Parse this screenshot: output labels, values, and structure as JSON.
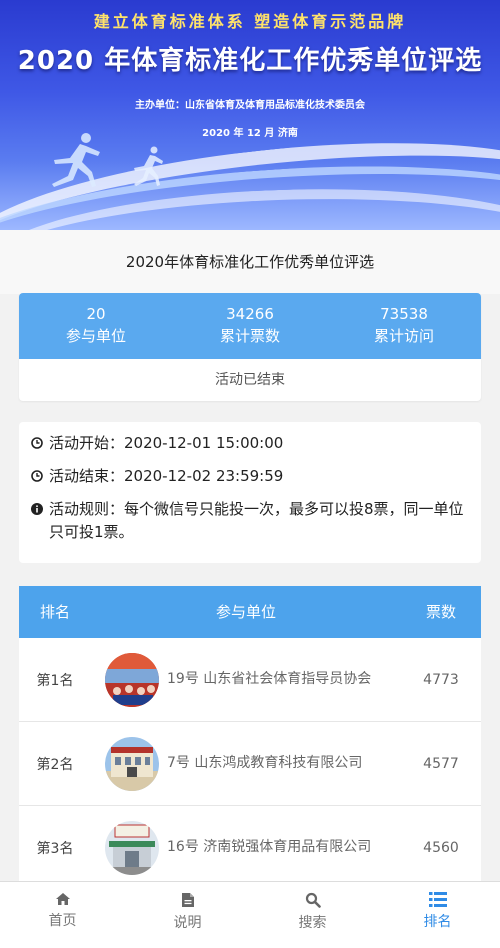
{
  "banner": {
    "slogan": "建立体育标准体系   塑造体育示范品牌",
    "title": "2020 年体育标准化工作优秀单位评选",
    "organizer": "主办单位：山东省体育及体育用品标准化技术委员会",
    "date": "2020 年 12 月  济南"
  },
  "page_title": "2020年体育标准化工作优秀单位评选",
  "stats": [
    {
      "value": "20",
      "label": "参与单位"
    },
    {
      "value": "34266",
      "label": "累计票数"
    },
    {
      "value": "73538",
      "label": "累计访问"
    }
  ],
  "status": "活动已结束",
  "info": {
    "start": "活动开始：2020-12-01 15:00:00",
    "end": "活动结束：2020-12-02 23:59:59",
    "rules": "活动规则：每个微信号只能投一次，最多可以投8票，同一单位只可投1票。"
  },
  "ranking": {
    "headers": {
      "rank": "排名",
      "unit": "参与单位",
      "votes": "票数"
    },
    "rows": [
      {
        "rank": "第1名",
        "name": "19号 山东省社会体育指导员协会",
        "votes": "4773"
      },
      {
        "rank": "第2名",
        "name": "7号 山东鸿成教育科技有限公司",
        "votes": "4577"
      },
      {
        "rank": "第3名",
        "name": "16号 济南锐强体育用品有限公司",
        "votes": "4560"
      }
    ]
  },
  "nav": [
    {
      "label": "首页",
      "icon": "home-icon"
    },
    {
      "label": "说明",
      "icon": "document-icon"
    },
    {
      "label": "搜索",
      "icon": "search-icon"
    },
    {
      "label": "排名",
      "icon": "list-icon"
    }
  ],
  "colors": {
    "accent": "#4da3ec",
    "stats_bg": "#5aa9ef",
    "active_nav": "#2f8be6",
    "slogan": "#ffe36a"
  }
}
